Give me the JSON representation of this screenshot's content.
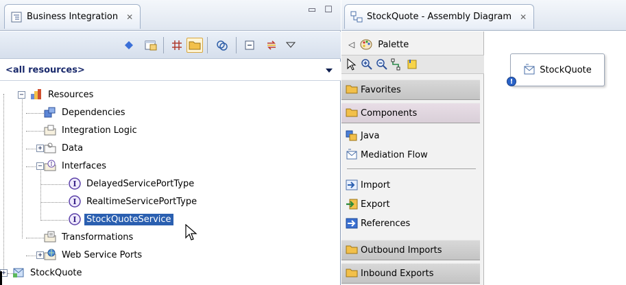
{
  "left_view": {
    "title": "Business Integration",
    "close_glyph": "✕",
    "minimize_glyph": "▭",
    "maximize_glyph": "☐",
    "filter_label": "<all resources>",
    "toolbar_icons": [
      "link-with-editor-icon",
      "new-module-icon",
      "show-grid-icon",
      "show-folders-icon",
      "refresh-icon",
      "collapse-all-icon",
      "sync-icon",
      "view-menu-icon"
    ]
  },
  "tree": {
    "items": [
      {
        "label": "Resources",
        "icon": "resources-icon",
        "expander": "−"
      },
      {
        "label": "Dependencies",
        "icon": "dependencies-icon"
      },
      {
        "label": "Integration Logic",
        "icon": "integration-logic-icon"
      },
      {
        "label": "Data",
        "icon": "data-folder-icon",
        "expander": "+"
      },
      {
        "label": "Interfaces",
        "icon": "interfaces-folder-icon",
        "expander": "−"
      },
      {
        "label": "DelayedServicePortType",
        "icon": "interface-icon"
      },
      {
        "label": "RealtimeServicePortType",
        "icon": "interface-icon"
      },
      {
        "label": "StockQuoteService",
        "icon": "interface-icon",
        "selected": true
      },
      {
        "label": "Transformations",
        "icon": "transformations-icon"
      },
      {
        "label": "Web Service Ports",
        "icon": "web-service-ports-icon",
        "expander": "+"
      },
      {
        "label": "StockQuote",
        "icon": "module-icon",
        "expander": "+"
      }
    ]
  },
  "right_view": {
    "title": "StockQuote - Assembly Diagram",
    "close_glyph": "✕",
    "palette": {
      "collapse_glyph": "◁",
      "label": "Palette",
      "drawers": [
        {
          "label": "Favorites"
        },
        {
          "label": "Components"
        },
        {
          "label": "Outbound Imports"
        },
        {
          "label": "Inbound Exports"
        }
      ],
      "entries": [
        {
          "label": "Java",
          "icon": "java-component-icon"
        },
        {
          "label": "Mediation Flow",
          "icon": "mediation-flow-icon"
        },
        {
          "label": "Import",
          "icon": "import-icon"
        },
        {
          "label": "Export",
          "icon": "export-icon"
        },
        {
          "label": "References",
          "icon": "references-icon"
        }
      ]
    },
    "canvas": {
      "component_label": "StockQuote",
      "badge_glyph": "!"
    }
  },
  "colors": {
    "selection": "#2a5fb0",
    "view_border": "#8a9bb5",
    "tab_gradient_top": "#f4f7fb",
    "folder_yellow": "#f2c04a"
  }
}
